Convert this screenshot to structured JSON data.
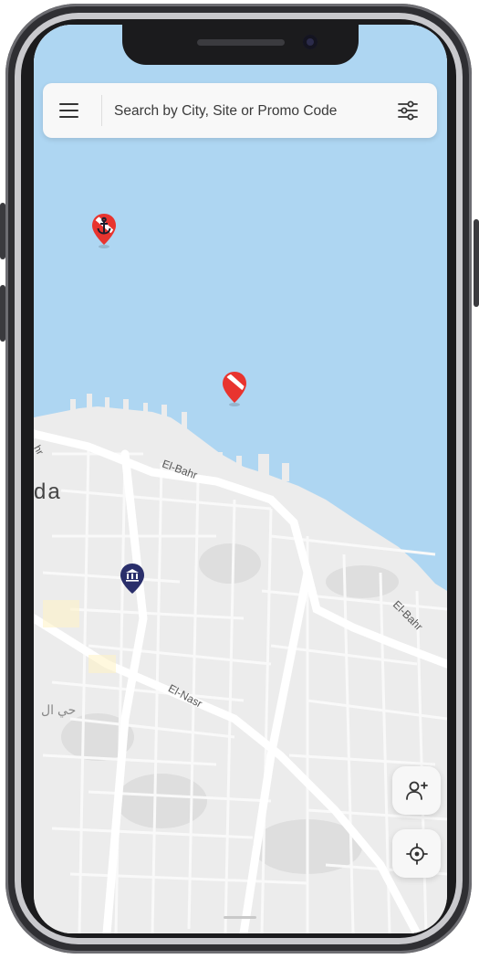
{
  "search": {
    "placeholder": "Search by City, Site or Promo Code"
  },
  "map": {
    "sea_color": "#aed6f2",
    "land_color": "#ececec",
    "road_color": "#ffffff",
    "labels": {
      "city_partial": "da",
      "road_top": "El-Bahr",
      "road_right": "El-Bahr",
      "road_middle": "El-Nasr",
      "road_edge": "hr",
      "district_arabic": "حي ال"
    },
    "pins": [
      {
        "type": "dive-site-anchor",
        "color": "#e8342f"
      },
      {
        "type": "dive-site",
        "color": "#e8342f"
      },
      {
        "type": "museum",
        "color": "#2a2f6b"
      }
    ]
  },
  "actions": {
    "add_buddy_icon": "add-person-icon",
    "locate_icon": "my-location-icon"
  },
  "colors": {
    "frame": "#2f2f33",
    "accent_red": "#e8342f",
    "accent_navy": "#2a2f6b"
  }
}
